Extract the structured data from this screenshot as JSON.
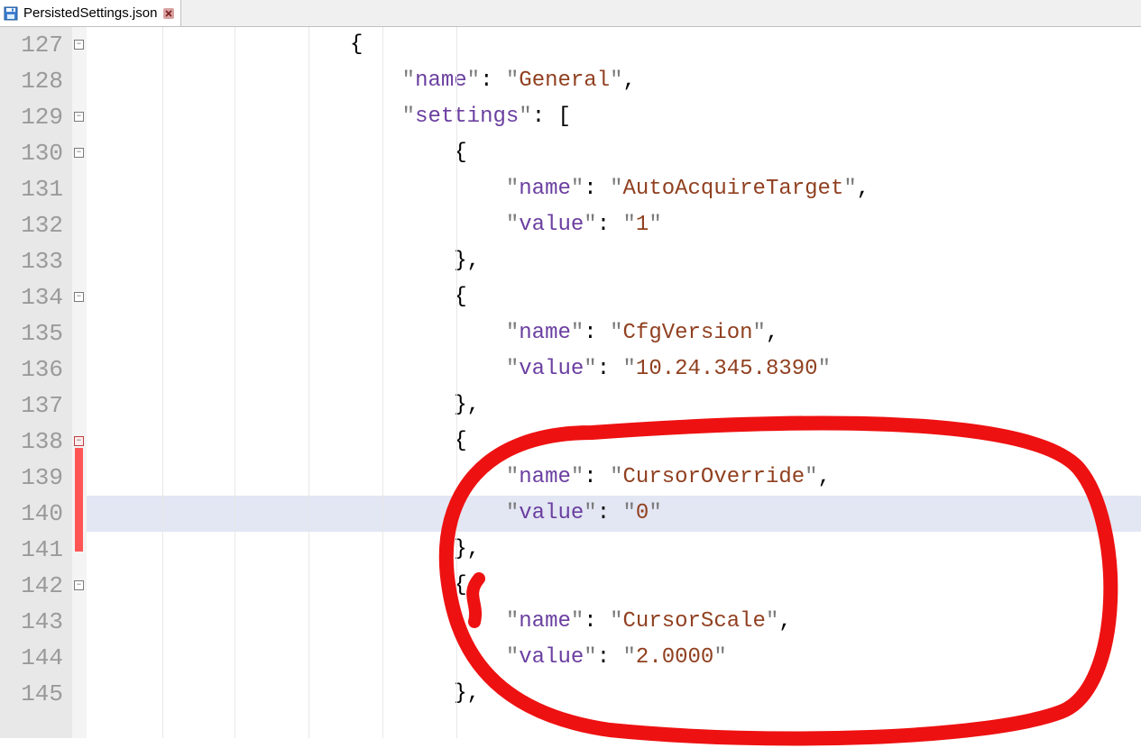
{
  "tab": {
    "filename": "PersistedSettings.json"
  },
  "lineNumbers": [
    "127",
    "128",
    "129",
    "130",
    "131",
    "132",
    "133",
    "134",
    "135",
    "136",
    "137",
    "138",
    "139",
    "140",
    "141",
    "142",
    "143",
    "144",
    "145"
  ],
  "highlightedLineIndex": 13,
  "code": {
    "line127": {
      "indent": "                    ",
      "brace_open": "{"
    },
    "line128": {
      "indent": "                        ",
      "q": "\"",
      "key_name": "name",
      "colon_sp": ": ",
      "val_general": "General",
      "comma": ","
    },
    "line129": {
      "indent": "                        ",
      "q": "\"",
      "key_settings": "settings",
      "colon_sp": ": ",
      "bracket_open": "["
    },
    "line130": {
      "indent": "                            ",
      "brace_open": "{"
    },
    "line131": {
      "indent": "                                ",
      "q": "\"",
      "key_name": "name",
      "colon_sp": ": ",
      "val": "AutoAcquireTarget",
      "comma": ","
    },
    "line132": {
      "indent": "                                ",
      "q": "\"",
      "key_value": "value",
      "colon_sp": ": ",
      "val": "1"
    },
    "line133": {
      "indent": "                            ",
      "brace_close": "}",
      "comma": ","
    },
    "line134": {
      "indent": "                            ",
      "brace_open": "{"
    },
    "line135": {
      "indent": "                                ",
      "q": "\"",
      "key_name": "name",
      "colon_sp": ": ",
      "val": "CfgVersion",
      "comma": ","
    },
    "line136": {
      "indent": "                                ",
      "q": "\"",
      "key_value": "value",
      "colon_sp": ": ",
      "val": "10.24.345.8390"
    },
    "line137": {
      "indent": "                            ",
      "brace_close": "}",
      "comma": ","
    },
    "line138": {
      "indent": "                            ",
      "brace_open": "{"
    },
    "line139": {
      "indent": "                                ",
      "q": "\"",
      "key_name": "name",
      "colon_sp": ": ",
      "val": "CursorOverride",
      "comma": ","
    },
    "line140": {
      "indent": "                                ",
      "q": "\"",
      "key_value": "value",
      "colon_sp": ": ",
      "val": "0"
    },
    "line141": {
      "indent": "                            ",
      "brace_close": "}",
      "comma": ","
    },
    "line142": {
      "indent": "                            ",
      "brace_open": "{"
    },
    "line143": {
      "indent": "                                ",
      "q": "\"",
      "key_name": "name",
      "colon_sp": ": ",
      "val": "CursorScale",
      "comma": ","
    },
    "line144": {
      "indent": "                                ",
      "q": "\"",
      "key_value": "value",
      "colon_sp": ": ",
      "val": "2.0000"
    },
    "line145": {
      "indent": "                            ",
      "brace_close": "}",
      "comma": ","
    }
  }
}
